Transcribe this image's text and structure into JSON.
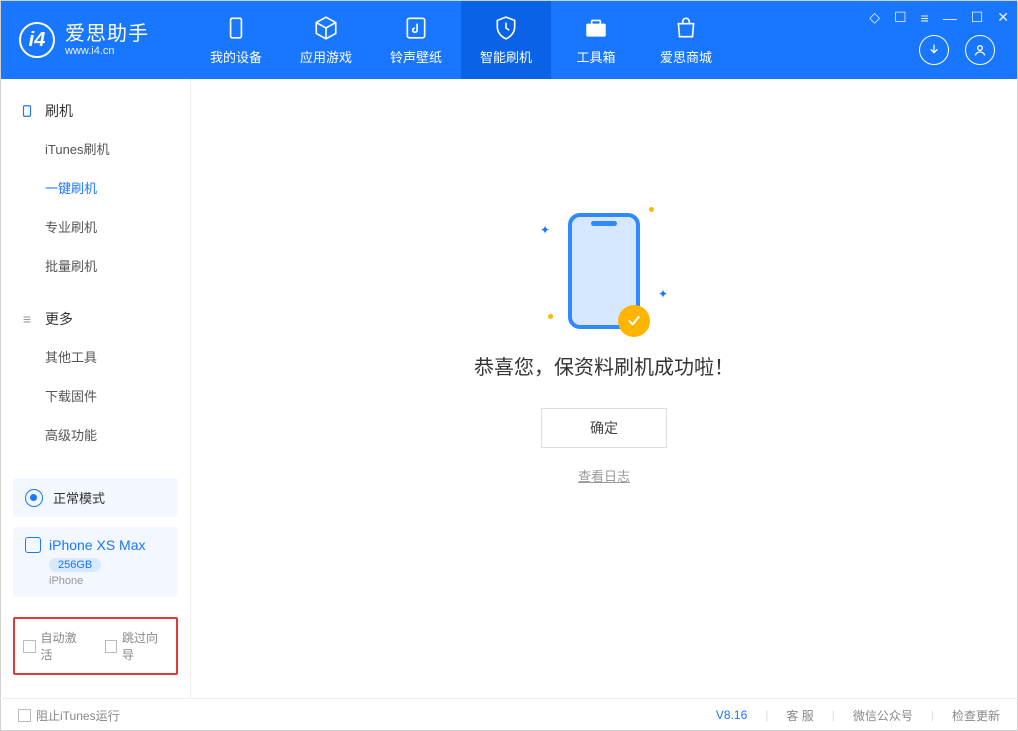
{
  "app": {
    "title": "爱思助手",
    "subtitle": "www.i4.cn"
  },
  "tabs": [
    {
      "label": "我的设备"
    },
    {
      "label": "应用游戏"
    },
    {
      "label": "铃声壁纸"
    },
    {
      "label": "智能刷机"
    },
    {
      "label": "工具箱"
    },
    {
      "label": "爱思商城"
    }
  ],
  "sidebar": {
    "section1_title": "刷机",
    "section1_items": [
      "iTunes刷机",
      "一键刷机",
      "专业刷机",
      "批量刷机"
    ],
    "section2_title": "更多",
    "section2_items": [
      "其他工具",
      "下载固件",
      "高级功能"
    ]
  },
  "device": {
    "mode": "正常模式",
    "name": "iPhone XS Max",
    "capacity": "256GB",
    "type": "iPhone"
  },
  "bottom_checks": {
    "auto_activate": "自动激活",
    "skip_guide": "跳过向导"
  },
  "main": {
    "success_message": "恭喜您，保资料刷机成功啦！",
    "ok_button": "确定",
    "view_log": "查看日志"
  },
  "footer": {
    "block_itunes": "阻止iTunes运行",
    "version": "V8.16",
    "support": "客 服",
    "wechat": "微信公众号",
    "check_update": "检查更新"
  }
}
